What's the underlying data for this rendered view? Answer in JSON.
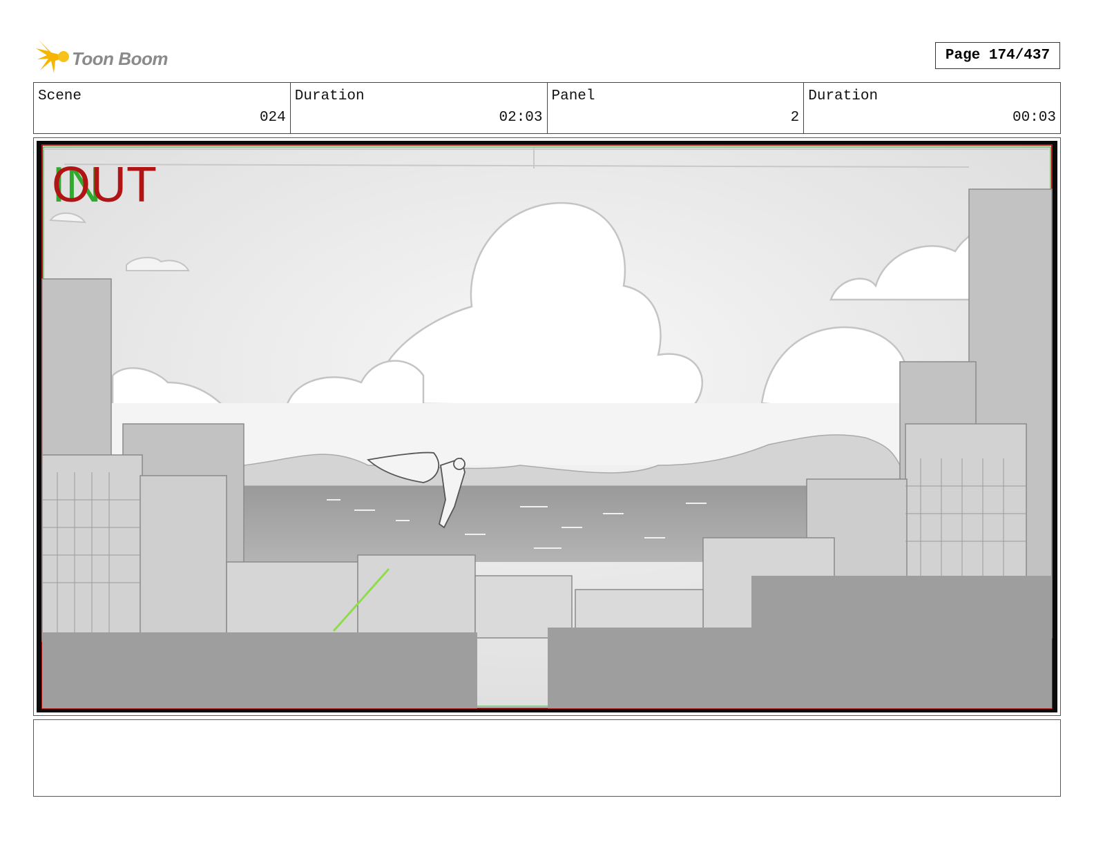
{
  "brand": {
    "name": "Toon Boom",
    "accent": "#f5b500"
  },
  "page": {
    "label": "Page 174/437"
  },
  "info": [
    {
      "label": "Scene",
      "value": "024"
    },
    {
      "label": "Duration",
      "value": "02:03"
    },
    {
      "label": "Panel",
      "value": "2"
    },
    {
      "label": "Duration",
      "value": "00:03"
    }
  ],
  "panel": {
    "in_label": "IN",
    "out_label": "OUT",
    "in_color": "#2faa2f",
    "out_color": "#b01414"
  },
  "notes": {
    "text": ""
  }
}
